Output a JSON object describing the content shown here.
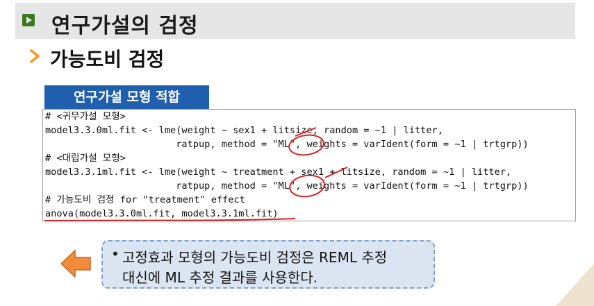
{
  "header": {
    "title": "연구가설의 검정"
  },
  "subhead": {
    "text": "가능도비 검정"
  },
  "code_section": {
    "tab_label": "연구가설 모형 적합",
    "lines": [
      "# <귀무가설 모형>",
      "model3.3.0ml.fit <- lme(weight ~ sex1 + litsize, random = ~1 | litter,",
      "                       ratpup, method = \"ML\", weights = varIdent(form = ~1 | trtgrp))",
      "# <대립가설 모형>",
      "model3.3.1ml.fit <- lme(weight ~ treatment + sex1 + litsize, random = ~1 | litter,",
      "                       ratpup, method = \"ML\", weights = varIdent(form = ~1 | trtgrp))",
      "# 가능도비 검정 for \"treatment\" effect",
      "anova(model3.3.0ml.fit, model3.3.1ml.fit)"
    ]
  },
  "note": {
    "bullet": "•",
    "line1": "고정효과 모형의 가능도비 검정은 REML 추정",
    "line2": "대신에 ML 추정 결과를 사용한다."
  },
  "colors": {
    "header_bg": "#e6e6e6",
    "header_mark": "#3a7a1c",
    "subhead_chevron": "#f0a030",
    "tab_bg": "#1f5fae",
    "annotation_red": "#e0201e",
    "note_bg": "#dbe5f1",
    "arrow_orange": "#f28b3c",
    "corner_beige": "#efe3cf"
  },
  "icons": {
    "header_mark": "play-square-icon",
    "subhead": "chevron-right-icon",
    "callout": "left-arrow-icon"
  }
}
